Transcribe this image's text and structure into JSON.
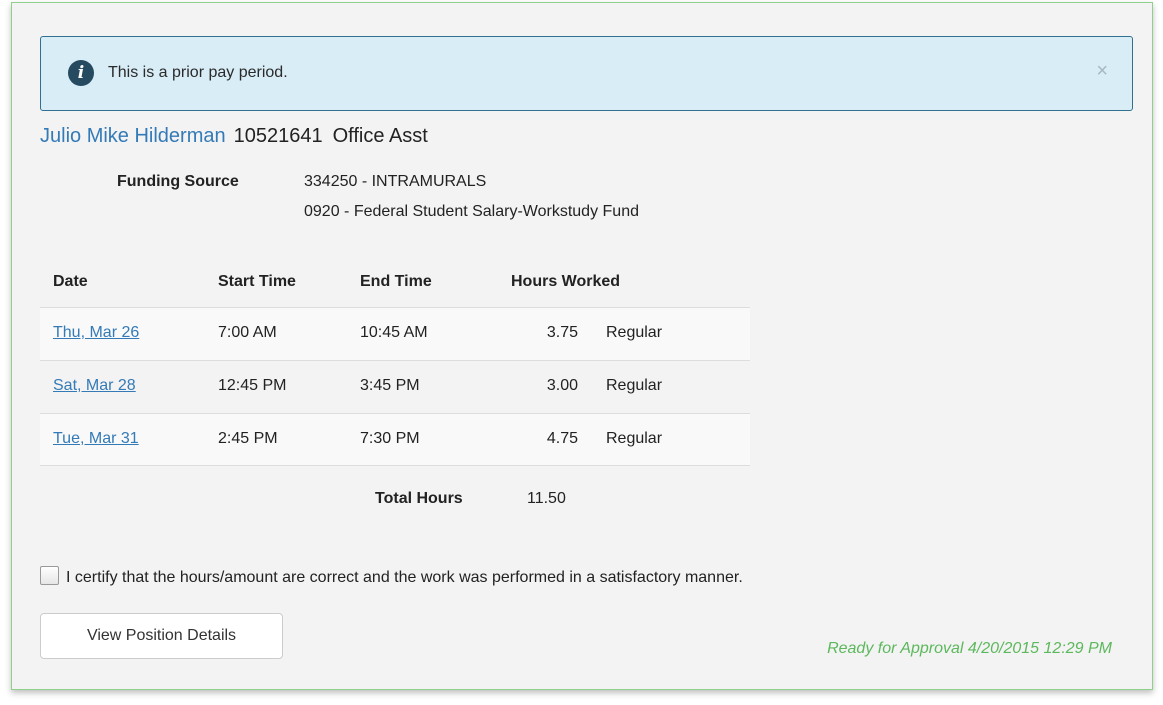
{
  "alert": {
    "icon": "info-icon",
    "message": "This is a prior pay period.",
    "close_symbol": "×"
  },
  "employee": {
    "name": "Julio Mike Hilderman",
    "id": "10521641",
    "position_title": "Office Asst"
  },
  "funding": {
    "label": "Funding Source",
    "lines": [
      "334250 - INTRAMURALS",
      "0920 - Federal Student Salary-Workstudy Fund"
    ]
  },
  "timesheet": {
    "headers": [
      "Date",
      "Start Time",
      "End Time",
      "Hours Worked"
    ],
    "rows": [
      {
        "date": "Thu, Mar 26",
        "start": "7:00 AM",
        "end": "10:45 AM",
        "hours": "3.75",
        "type": "Regular"
      },
      {
        "date": "Sat, Mar 28",
        "start": "12:45 PM",
        "end": "3:45 PM",
        "hours": "3.00",
        "type": "Regular"
      },
      {
        "date": "Tue, Mar 31",
        "start": "2:45 PM",
        "end": "7:30 PM",
        "hours": "4.75",
        "type": "Regular"
      }
    ],
    "total_label": "Total Hours",
    "total_value": "11.50"
  },
  "certification": {
    "checked": false,
    "text": "I certify that the hours/amount are correct and the work was performed in a satisfactory manner."
  },
  "actions": {
    "view_details_label": "View Position Details"
  },
  "status": {
    "text": "Ready for Approval 4/20/2015 12:29 PM",
    "color": "#5cb85c"
  },
  "colors": {
    "link": "#337ab7",
    "alert_bg": "#d9edf7",
    "alert_border": "#31708f",
    "panel_border": "#8fd08a"
  }
}
